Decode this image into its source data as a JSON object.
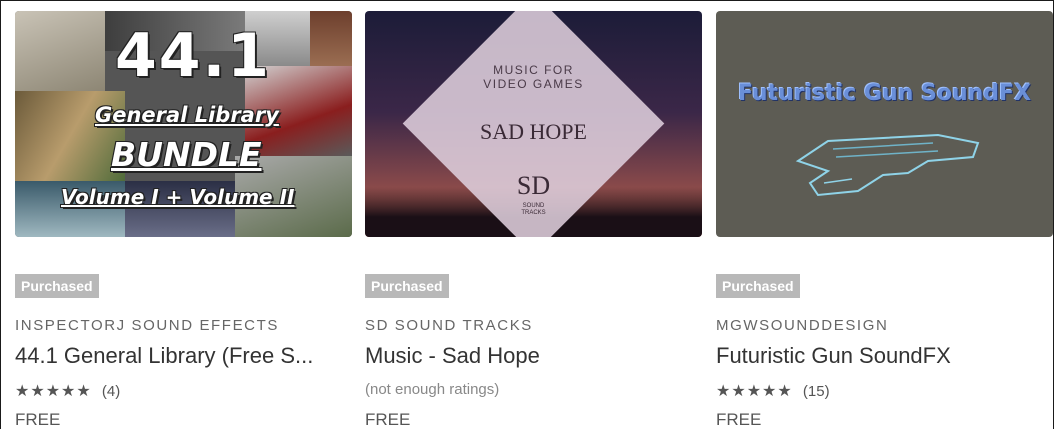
{
  "products": [
    {
      "badge": "Purchased",
      "publisher": "INSPECTORJ SOUND EFFECTS",
      "title": "44.1 General Library (Free S...",
      "stars": "★★★★★",
      "rating_text": "(4)",
      "price": "FREE",
      "art": {
        "line1": "44.1",
        "line2": "General Library",
        "line3": "BUNDLE",
        "line4": "Volume I + Volume II"
      }
    },
    {
      "badge": "Purchased",
      "publisher": "SD SOUND TRACKS",
      "title": "Music - Sad Hope",
      "stars": "",
      "rating_text": "(not enough ratings)",
      "price": "FREE",
      "art": {
        "top1": "MUSIC FOR",
        "top2": "VIDEO GAMES",
        "mid": "SAD HOPE",
        "logo": "SD",
        "sub1": "SOUND",
        "sub2": "TRACKS"
      }
    },
    {
      "badge": "Purchased",
      "publisher": "MGWSOUNDDESIGN",
      "title": "Futuristic Gun SoundFX",
      "stars": "★★★★★",
      "rating_text": "(15)",
      "price": "FREE",
      "art": {
        "heading": "Futuristic Gun SoundFX"
      }
    }
  ],
  "colors": {
    "badge_bg": "#b8b8b8",
    "text_dark": "#333333",
    "text_muted": "#666666"
  }
}
